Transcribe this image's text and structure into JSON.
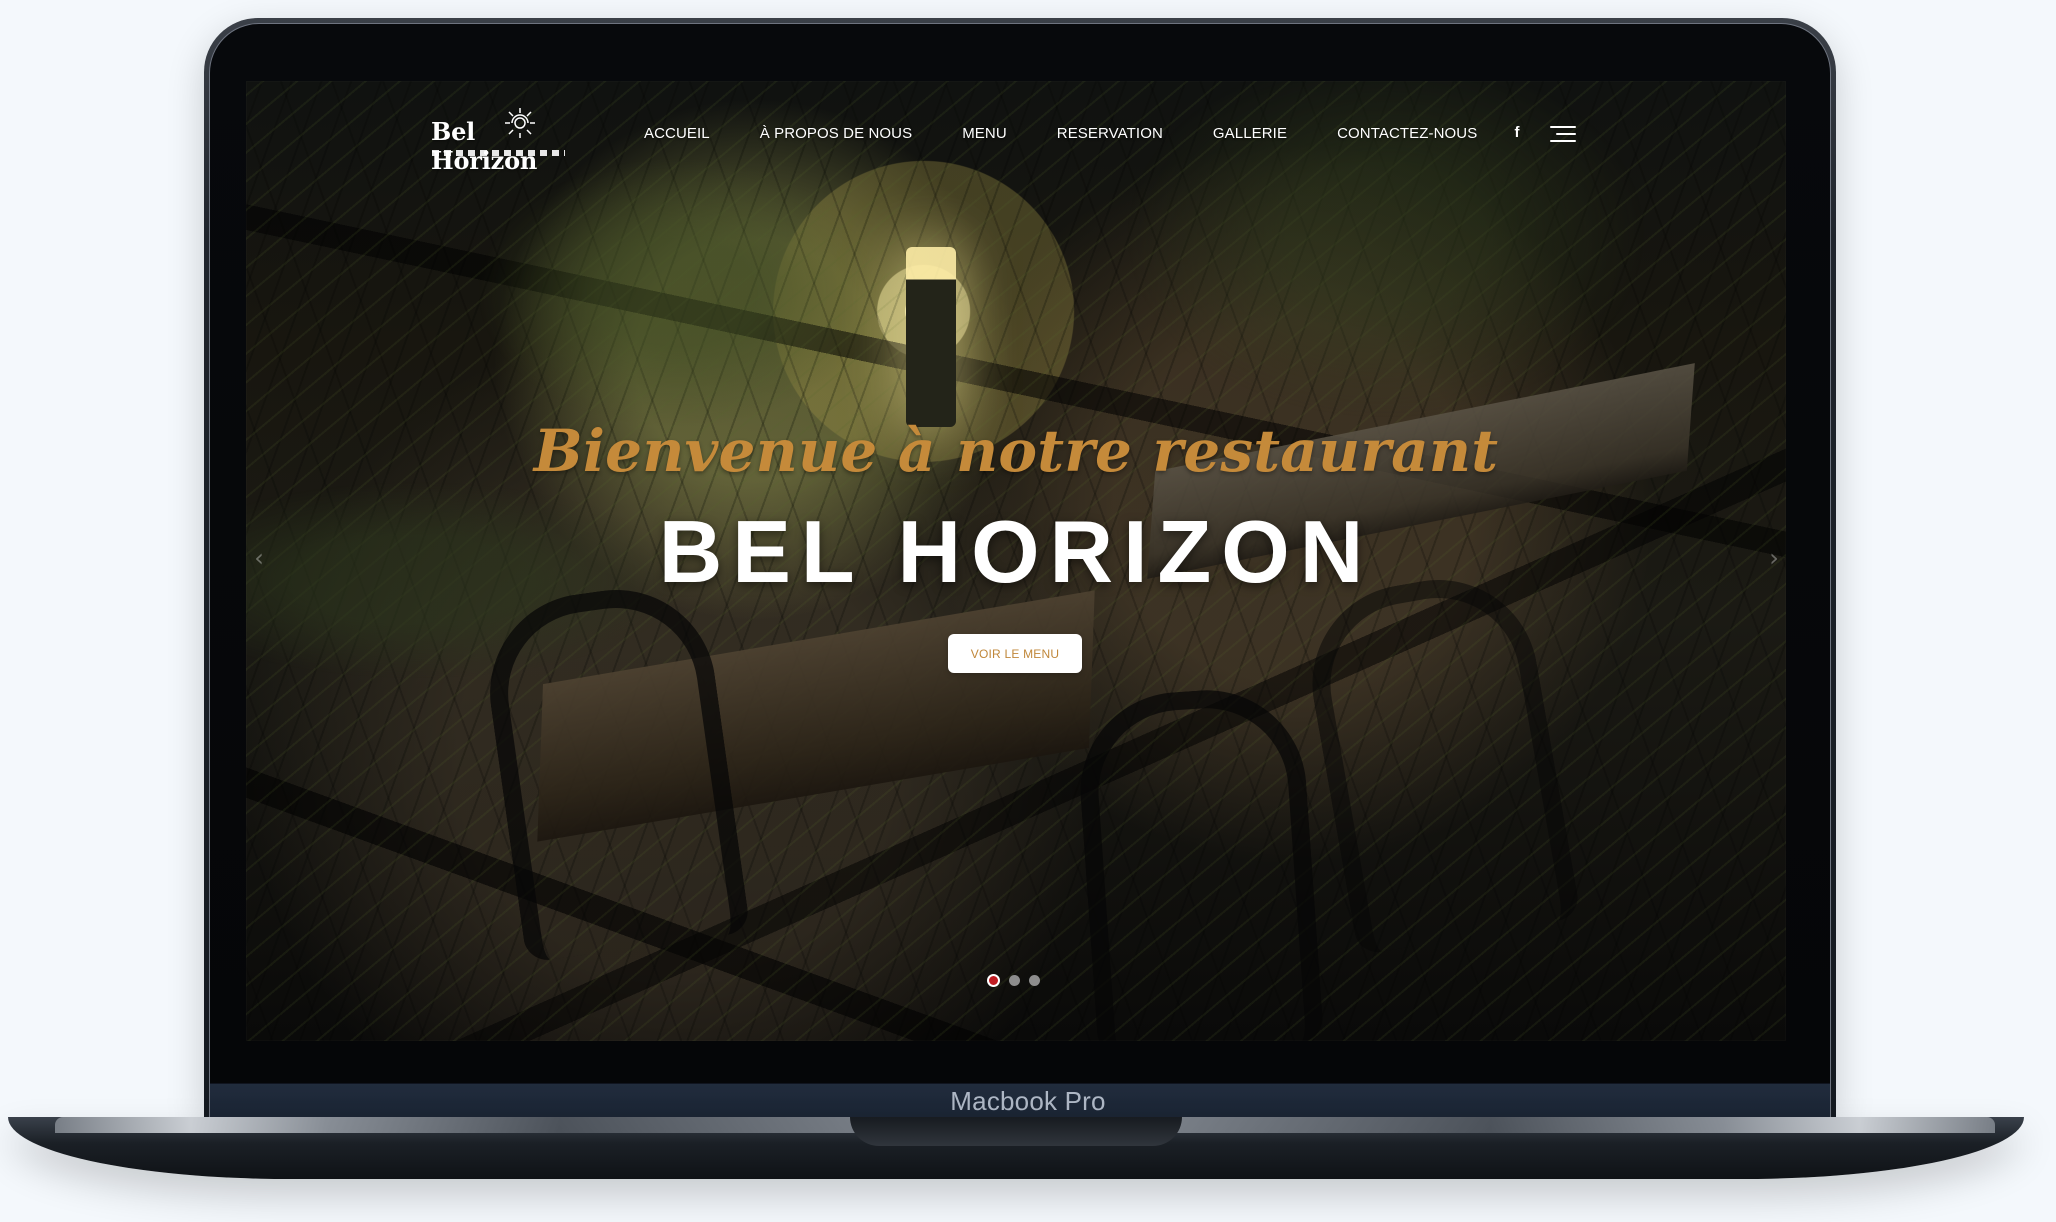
{
  "device": {
    "label": "Macbook Pro"
  },
  "site": {
    "logo_text": "Bel Horizon",
    "nav": [
      {
        "label": "ACCUEIL"
      },
      {
        "label": "À PROPOS DE NOUS"
      },
      {
        "label": "MENU"
      },
      {
        "label": "RESERVATION"
      },
      {
        "label": "GALLERIE"
      },
      {
        "label": "CONTACTEZ-NOUS"
      }
    ],
    "social": {
      "facebook_icon": "f"
    }
  },
  "hero": {
    "welcome": "Bienvenue à notre restaurant",
    "title": "BEL HORIZON",
    "button_label": "VOIR LE MENU",
    "left_arrow": "‹",
    "right_arrow": "›",
    "slides": 3,
    "active_slide": 1
  },
  "colors": {
    "accent": "#c58a3a",
    "active_dot": "#c01c22"
  }
}
